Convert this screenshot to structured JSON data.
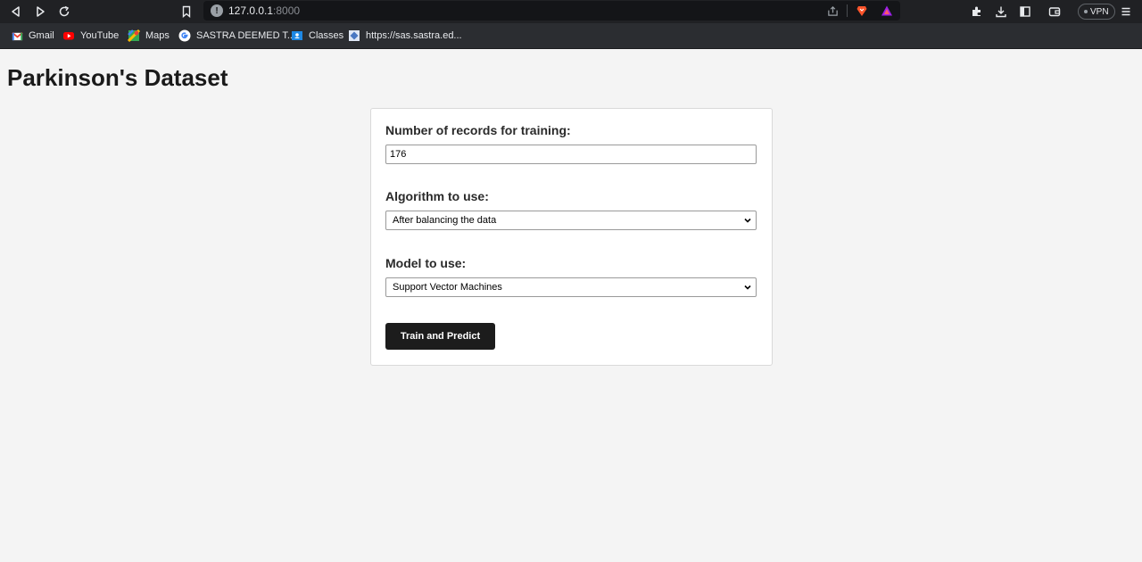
{
  "browser": {
    "url_host": "127.0.0.1",
    "url_port": ":8000",
    "vpn_label": "VPN",
    "bookmarks": [
      {
        "label": "Gmail",
        "icon": "gmail-icon",
        "color": "#ea4335"
      },
      {
        "label": "YouTube",
        "icon": "youtube-icon",
        "color": "#ff0000"
      },
      {
        "label": "Maps",
        "icon": "maps-icon",
        "color": "#34a853"
      },
      {
        "label": "SASTRA DEEMED T...",
        "icon": "google-icon",
        "color": "#ffffff"
      },
      {
        "label": "Classes",
        "icon": "classroom-icon",
        "color": "#1e88e5"
      },
      {
        "label": "https://sas.sastra.ed...",
        "icon": "site-icon",
        "color": "#4a78c2"
      }
    ]
  },
  "page": {
    "title": "Parkinson's Dataset"
  },
  "form": {
    "records_label": "Number of records for training:",
    "records_value": "176",
    "algorithm_label": "Algorithm to use:",
    "algorithm_selected": "After balancing the data",
    "model_label": "Model to use:",
    "model_selected": "Support Vector Machines",
    "submit_label": "Train and Predict"
  }
}
